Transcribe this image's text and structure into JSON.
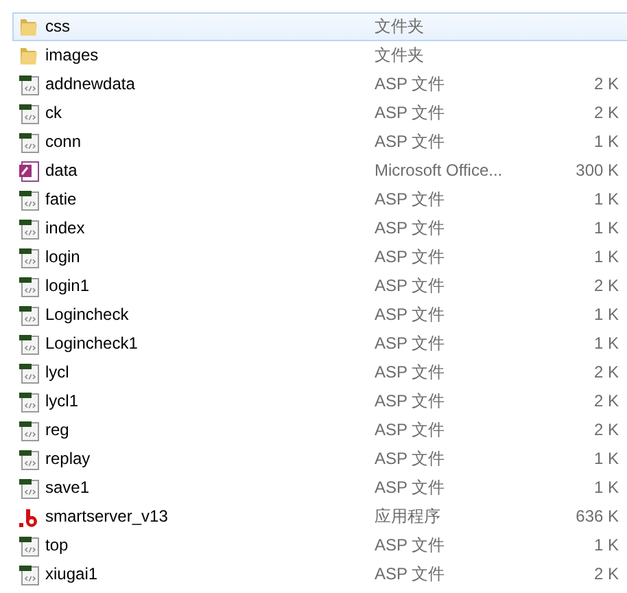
{
  "files": [
    {
      "name": "css",
      "type": "文件夹",
      "kind": "folder",
      "selected": true
    },
    {
      "name": "images",
      "type": "文件夹",
      "kind": "folder",
      "selected": false
    },
    {
      "name": "addnewdata",
      "type": "ASP 文件",
      "size": "2 K",
      "kind": "asp",
      "selected": false
    },
    {
      "name": "ck",
      "type": "ASP 文件",
      "size": "2 K",
      "kind": "asp",
      "selected": false
    },
    {
      "name": "conn",
      "type": "ASP 文件",
      "size": "1 K",
      "kind": "asp",
      "selected": false
    },
    {
      "name": "data",
      "type": "Microsoft Office...",
      "size": "300 K",
      "kind": "access",
      "selected": false
    },
    {
      "name": "fatie",
      "type": "ASP 文件",
      "size": "1 K",
      "kind": "asp",
      "selected": false
    },
    {
      "name": "index",
      "type": "ASP 文件",
      "size": "1 K",
      "kind": "asp",
      "selected": false
    },
    {
      "name": "login",
      "type": "ASP 文件",
      "size": "1 K",
      "kind": "asp",
      "selected": false
    },
    {
      "name": "login1",
      "type": "ASP 文件",
      "size": "2 K",
      "kind": "asp",
      "selected": false
    },
    {
      "name": "Logincheck",
      "type": "ASP 文件",
      "size": "1 K",
      "kind": "asp",
      "selected": false
    },
    {
      "name": "Logincheck1",
      "type": "ASP 文件",
      "size": "1 K",
      "kind": "asp",
      "selected": false
    },
    {
      "name": "lycl",
      "type": "ASP 文件",
      "size": "2 K",
      "kind": "asp",
      "selected": false
    },
    {
      "name": "lycl1",
      "type": "ASP 文件",
      "size": "2 K",
      "kind": "asp",
      "selected": false
    },
    {
      "name": "reg",
      "type": "ASP 文件",
      "size": "2 K",
      "kind": "asp",
      "selected": false
    },
    {
      "name": "replay",
      "type": "ASP 文件",
      "size": "1 K",
      "kind": "asp",
      "selected": false
    },
    {
      "name": "save1",
      "type": "ASP 文件",
      "size": "1 K",
      "kind": "asp",
      "selected": false
    },
    {
      "name": "smartserver_v13",
      "type": "应用程序",
      "size": "636 K",
      "kind": "exe",
      "selected": false
    },
    {
      "name": "top",
      "type": "ASP 文件",
      "size": "1 K",
      "kind": "asp",
      "selected": false
    },
    {
      "name": "xiugai1",
      "type": "ASP 文件",
      "size": "2 K",
      "kind": "asp",
      "selected": false
    }
  ]
}
